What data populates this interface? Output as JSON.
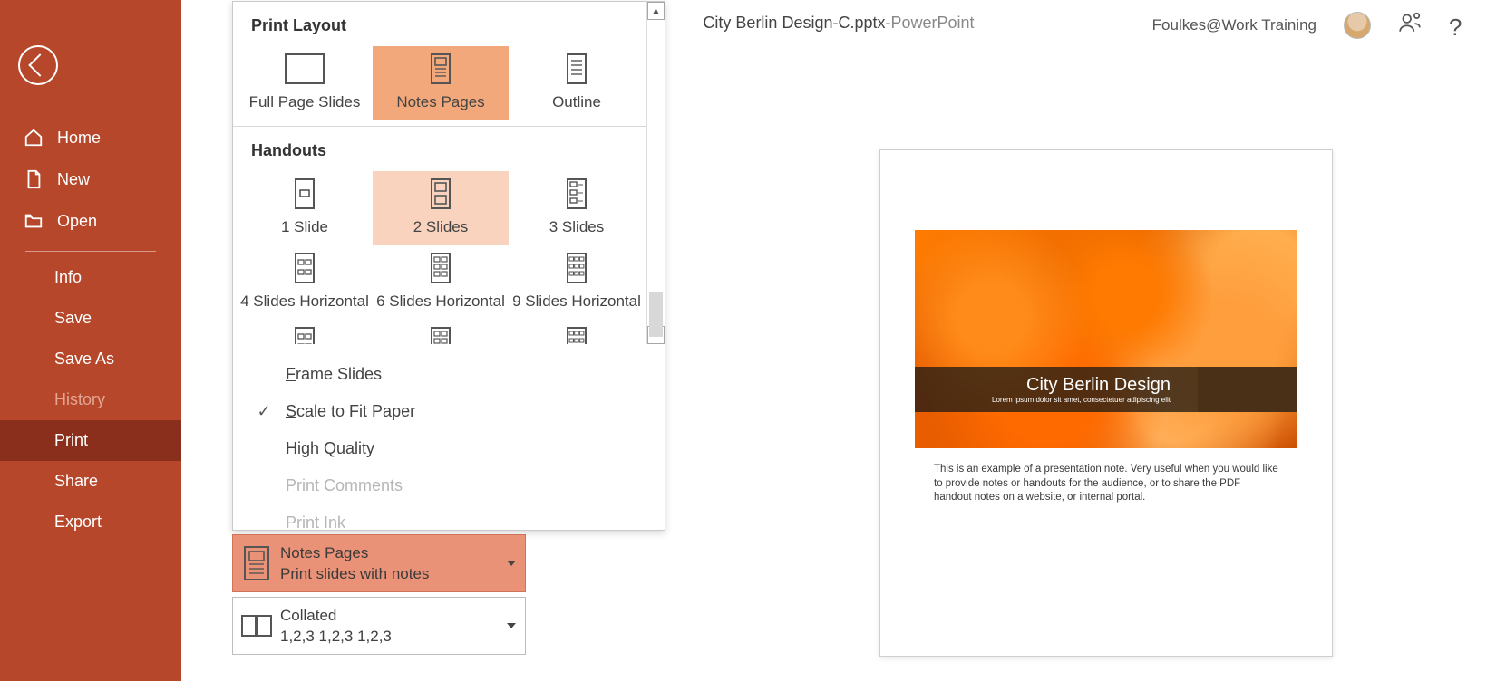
{
  "titlebar": {
    "filename": "City Berlin Design-C.pptx",
    "separator": "  -  ",
    "appname": "PowerPoint",
    "account": "Foulkes@Work Training"
  },
  "sidebar": {
    "home": "Home",
    "new": "New",
    "open": "Open",
    "info": "Info",
    "save": "Save",
    "saveas": "Save As",
    "history": "History",
    "print": "Print",
    "share": "Share",
    "export": "Export"
  },
  "dropdown": {
    "section_print_layout": "Print Layout",
    "full_page": "Full Page Slides",
    "notes_pages": "Notes Pages",
    "outline": "Outline",
    "section_handouts": "Handouts",
    "h1": "1 Slide",
    "h2": "2 Slides",
    "h3": "3 Slides",
    "h4": "4 Slides Horizontal",
    "h6": "6 Slides Horizontal",
    "h9": "9 Slides Horizontal",
    "frame": "Frame Slides",
    "scale": "Scale to Fit Paper",
    "hq": "High Quality",
    "comments": "Print Comments",
    "ink": "Print Ink"
  },
  "settings": {
    "layout_title": "Notes Pages",
    "layout_sub": "Print slides with notes",
    "collate_title": "Collated",
    "collate_sub": "1,2,3    1,2,3    1,2,3"
  },
  "preview": {
    "slide_title": "City Berlin Design",
    "slide_sub": "Lorem ipsum dolor sit amet, consectetuer adipiscing elit",
    "notes": "This is an example of a presentation note. Very useful when you would like to provide notes or handouts for the audience, or to share the PDF handout notes on a website, or internal portal."
  }
}
